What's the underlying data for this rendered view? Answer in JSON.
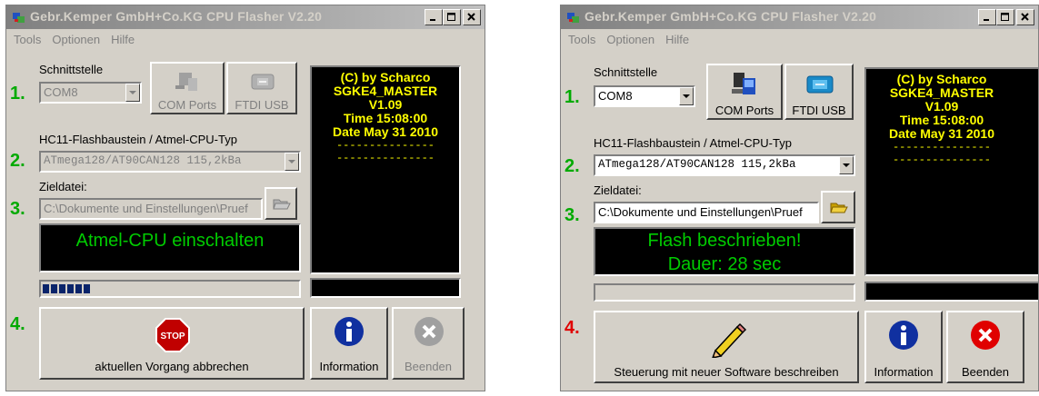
{
  "windows": [
    {
      "title": "Gebr.Kemper GmbH+Co.KG CPU Flasher V2.20",
      "menu": [
        "Tools",
        "Optionen",
        "Hilfe"
      ],
      "interface_label": "Schnittstelle",
      "interface_value": "COM8",
      "com_ports_label": "COM Ports",
      "ftdi_label": "FTDI USB",
      "cpu_type_label": "HC11-Flashbaustein / Atmel-CPU-Typ",
      "cpu_type_value": "ATmega128/AT90CAN128 115,2kBa",
      "target_label": "Zieldatei:",
      "target_value": "C:\\Dokumente und Einstellungen\\Pruef",
      "steps": [
        "1.",
        "2.",
        "3.",
        "4."
      ],
      "info_lines": [
        "(C) by Scharco",
        "SGKE4_MASTER",
        "V1.09",
        "Time 15:08:00",
        "Date May 31 2010"
      ],
      "info_dashes": [
        "---------------",
        "---------------"
      ],
      "status_lines": [
        "Atmel-CPU einschalten"
      ],
      "progress_segments": 6,
      "main_button_label": "aktuellen Vorgang abbrechen",
      "main_button_icon_text": "STOP",
      "info_button_label": "Information",
      "exit_button_label": "Beenden",
      "controls_enabled": false
    },
    {
      "title": "Gebr.Kemper GmbH+Co.KG CPU Flasher V2.20",
      "menu": [
        "Tools",
        "Optionen",
        "Hilfe"
      ],
      "interface_label": "Schnittstelle",
      "interface_value": "COM8",
      "com_ports_label": "COM Ports",
      "ftdi_label": "FTDI USB",
      "cpu_type_label": "HC11-Flashbaustein / Atmel-CPU-Typ",
      "cpu_type_value": "ATmega128/AT90CAN128 115,2kBa",
      "target_label": "Zieldatei:",
      "target_value": "C:\\Dokumente und Einstellungen\\Pruef",
      "steps": [
        "1.",
        "2.",
        "3.",
        "4."
      ],
      "info_lines": [
        "(C) by Scharco",
        "SGKE4_MASTER",
        "V1.09",
        "Time 15:08:00",
        "Date May 31 2010"
      ],
      "info_dashes": [
        "---------------",
        "---------------"
      ],
      "status_lines": [
        "Flash beschrieben!",
        "Dauer: 28 sec"
      ],
      "progress_segments": 0,
      "main_button_label": "Steuerung mit neuer Software beschreiben",
      "info_button_label": "Information",
      "exit_button_label": "Beenden",
      "controls_enabled": true
    }
  ],
  "colors": {
    "step_green": "#00aa00",
    "step4_red_active": "#e00000",
    "info_text_yellow": "#ffff00",
    "status_text_green": "#00cc00",
    "progress_blue": "#0a246a"
  }
}
